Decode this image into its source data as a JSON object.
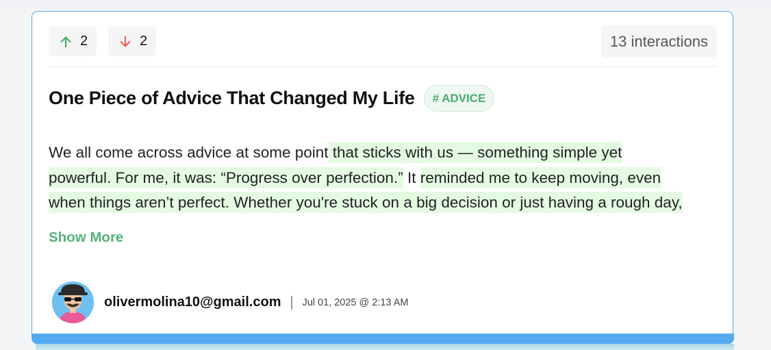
{
  "votes": {
    "up_count": "2",
    "down_count": "2",
    "up_icon": "arrow-up-icon",
    "down_icon": "arrow-down-icon",
    "up_color": "#4caf6a",
    "down_color": "#f0625a"
  },
  "interactions_label": "13 interactions",
  "post": {
    "title": "One Piece of Advice That Changed My Life",
    "tag": "# ADVICE",
    "body": {
      "line1_a": "We all come across advice at some point",
      "line1_b": " that sticks with us — so",
      "line1_c": "mething simple yet",
      "line2_a": "powe",
      "line2_b": "rful. For me, it was: “Progress over perfection.”",
      "line2_c": " It ",
      "line2_d": "reminded m",
      "line2_e": "e to keep moving, even",
      "line3_a": "when things aren’t perfect.",
      "line3_b": " Whether you're stuck on a big decision or just having a rough day,"
    },
    "show_more_label": "Show More"
  },
  "author": {
    "email": "olivermolina10@gmail.com",
    "date": "Jul 01, 2025 @ 2:13 AM"
  },
  "colors": {
    "card_border": "#5aa6ec",
    "accent_bar": "#54aaf0",
    "highlight": "#e4fbe2",
    "tag_text": "#4bac6e"
  }
}
